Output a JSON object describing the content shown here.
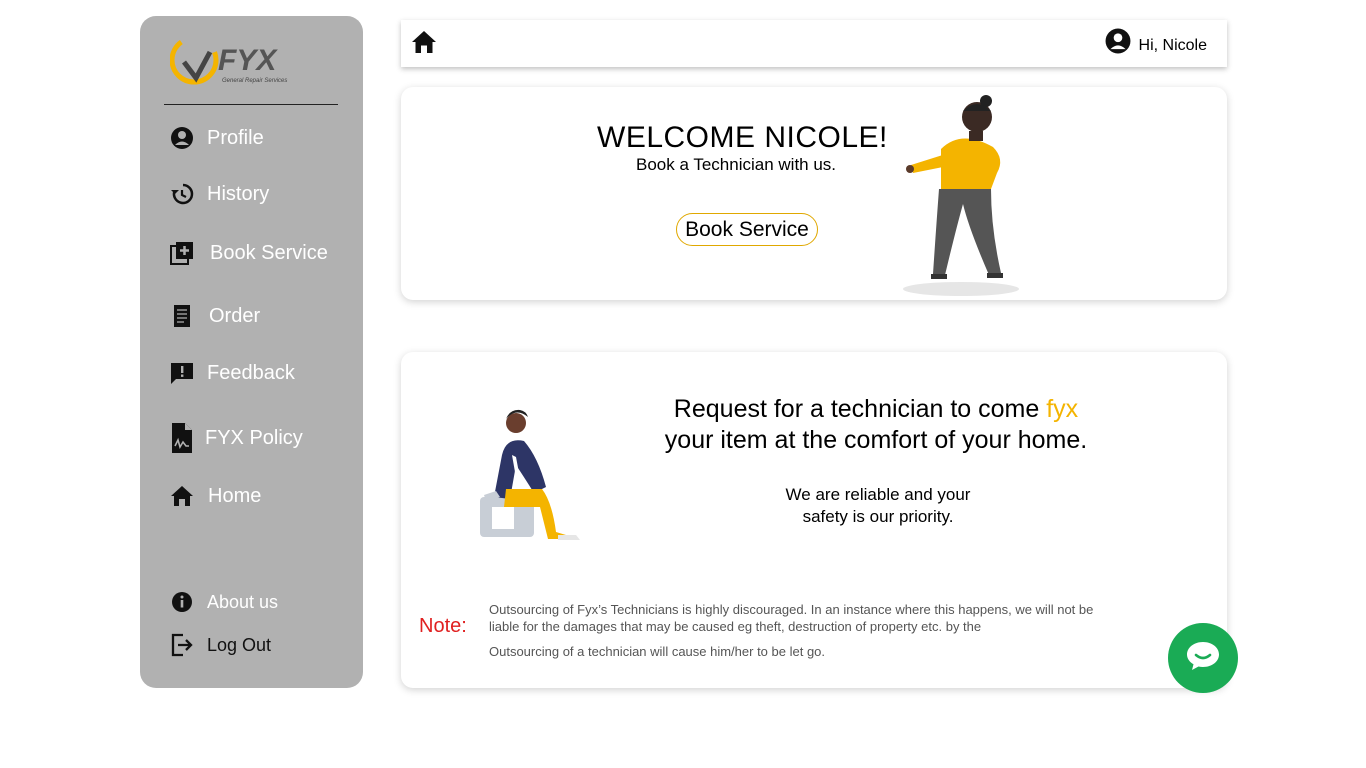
{
  "brand": {
    "logo_text": "FYX",
    "tagline": "General Repair Services"
  },
  "sidebar": {
    "items": [
      {
        "label": "Profile",
        "icon": "account-circle-icon"
      },
      {
        "label": "History",
        "icon": "history-icon"
      },
      {
        "label": "Book Service",
        "icon": "library-add-icon"
      },
      {
        "label": "Order",
        "icon": "receipt-icon"
      },
      {
        "label": "Feedback",
        "icon": "feedback-icon"
      },
      {
        "label": "FYX Policy",
        "icon": "document-signature-icon"
      },
      {
        "label": "Home",
        "icon": "home-icon"
      }
    ],
    "bottom": [
      {
        "label": "About us",
        "icon": "info-icon"
      },
      {
        "label": "Log Out",
        "icon": "logout-icon"
      }
    ]
  },
  "topbar": {
    "greeting": "Hi, Nicole",
    "home_icon": "home-icon",
    "user_icon": "account-circle-icon"
  },
  "welcome": {
    "title": "WELCOME NICOLE!",
    "subtitle": "Book a Technician with us.",
    "button_label": "Book Service"
  },
  "info": {
    "headline_part1": "Request for a technician to come ",
    "headline_accent": "fyx",
    "headline_part2": "your item at the comfort of your home.",
    "reliable_line1": "We are reliable and your",
    "reliable_line2": "safety is our priority.",
    "note_label": "Note:",
    "note_line1": "Outsourcing of Fyx’s Technicians is highly discouraged. In an instance where this happens, we will not be liable for the damages that may be caused eg theft, destruction of property etc. by the",
    "note_line2": "Outsourcing of a technician will cause him/her to be let go."
  },
  "colors": {
    "accent": "#f4b400",
    "sidebar_bg": "#b1b1b1",
    "chat": "#1aab55",
    "note": "#e02020"
  },
  "chat": {
    "icon": "chat-bubble-icon"
  }
}
